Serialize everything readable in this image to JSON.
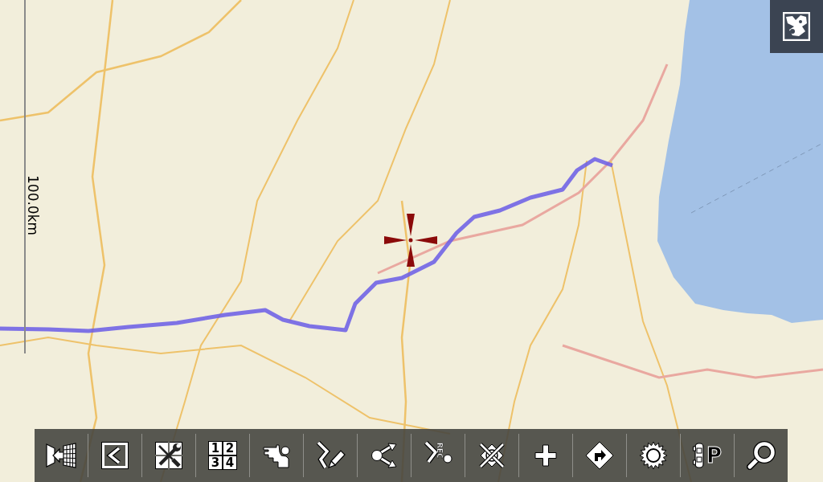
{
  "map": {
    "scale_label": "100.0km"
  },
  "corner_button": {
    "kind": "map_overview"
  },
  "toolbar": {
    "buttons": [
      {
        "kind": "exit"
      },
      {
        "kind": "collapse"
      },
      {
        "kind": "tools"
      },
      {
        "kind": "layout",
        "labels": [
          "1",
          "2",
          "3",
          "4"
        ]
      },
      {
        "kind": "person"
      },
      {
        "kind": "edit_route"
      },
      {
        "kind": "share"
      },
      {
        "kind": "record",
        "label": "REC"
      },
      {
        "kind": "clear"
      },
      {
        "kind": "add"
      },
      {
        "kind": "navigate"
      },
      {
        "kind": "sun"
      },
      {
        "kind": "parking",
        "label": "P"
      },
      {
        "kind": "search"
      }
    ]
  }
}
